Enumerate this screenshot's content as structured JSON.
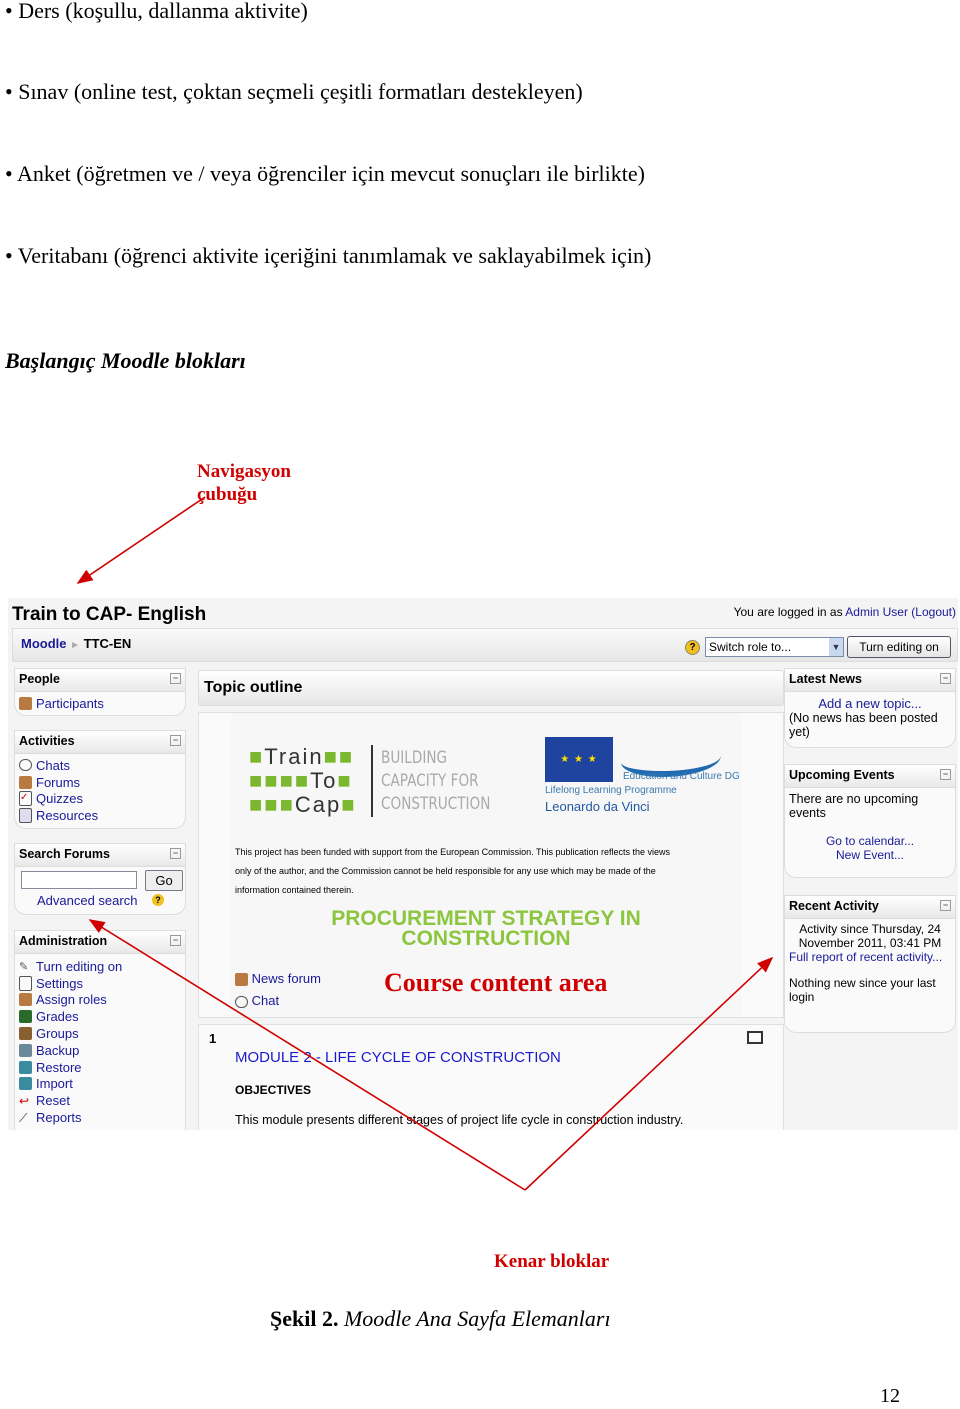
{
  "bullets": [
    "• Ders (koşullu, dallanma aktivite)",
    "• Sınav (online test, çoktan seçmeli çeşitli formatları destekleyen)",
    "• Anket (öğretmen ve / veya öğrenciler için mevcut sonuçları ile birlikte)",
    "• Veritabanı (öğrenci aktivite içeriğini tanımlamak ve saklayabilmek için)"
  ],
  "heading": "Başlangıç Moodle blokları",
  "annotations": {
    "nav_line1": "Navigasyon",
    "nav_line2": "çubuğu",
    "course_area": "Course content area",
    "side_blocks": "Kenar bloklar",
    "color": "#d00000"
  },
  "screenshot": {
    "site_title": "Train to CAP- English",
    "login": {
      "prefix": "You are logged in as ",
      "user": "Admin User",
      "logout": "(Logout)"
    },
    "breadcrumb": {
      "home": "Moodle",
      "sep": "►",
      "current": "TTC-EN"
    },
    "switch_role": "Switch role to...",
    "turn_editing": "Turn editing on",
    "people": {
      "title": "People",
      "items": [
        "Participants"
      ]
    },
    "activities": {
      "title": "Activities",
      "items": [
        "Chats",
        "Forums",
        "Quizzes",
        "Resources"
      ]
    },
    "search_forums": {
      "title": "Search Forums",
      "go": "Go",
      "advanced": "Advanced search",
      "value": ""
    },
    "administration": {
      "title": "Administration",
      "items": [
        "Turn editing on",
        "Settings",
        "Assign roles",
        "Grades",
        "Groups",
        "Backup",
        "Restore",
        "Import",
        "Reset",
        "Reports"
      ]
    },
    "topic_outline": "Topic outline",
    "logo": {
      "l1": "Train",
      "l2": "To",
      "l3": "Cap",
      "t1": "BUILDING",
      "t2": "CAPACITY FOR",
      "t3": "CONSTRUCTION",
      "eu1": "Education and Culture DG",
      "eu2": "Lifelong Learning Programme",
      "eu3": "Leonardo da Vinci"
    },
    "disclaimer": [
      "This project has been funded with support from the European Commission. This publication reflects the views",
      "only of the author, and the Commission cannot be held responsible for any use which may be made of the",
      "information contained therein."
    ],
    "course_title": [
      "PROCUREMENT STRATEGY IN",
      "CONSTRUCTION"
    ],
    "links": [
      "News forum",
      "Chat"
    ],
    "section_num": "1",
    "module_title": "MODULE 2 - LIFE CYCLE OF CONSTRUCTION",
    "objectives": "OBJECTIVES",
    "module_desc": "This module presents different stages of project life cycle in construction industry.",
    "latest_news": {
      "title": "Latest News",
      "add": "Add a new topic...",
      "none": "(No news has been posted yet)"
    },
    "upcoming": {
      "title": "Upcoming Events",
      "none": "There are no upcoming events",
      "calendar": "Go to calendar...",
      "new_event": "New Event..."
    },
    "recent": {
      "title": "Recent Activity",
      "since": "Activity since Thursday, 24 November 2011, 03:41 PM",
      "full": "Full report of recent activity...",
      "nothing": "Nothing new since your last login"
    }
  },
  "caption": {
    "label": "Şekil 2.",
    "text": " Moodle Ana Sayfa Elemanları"
  },
  "page_number": "12"
}
